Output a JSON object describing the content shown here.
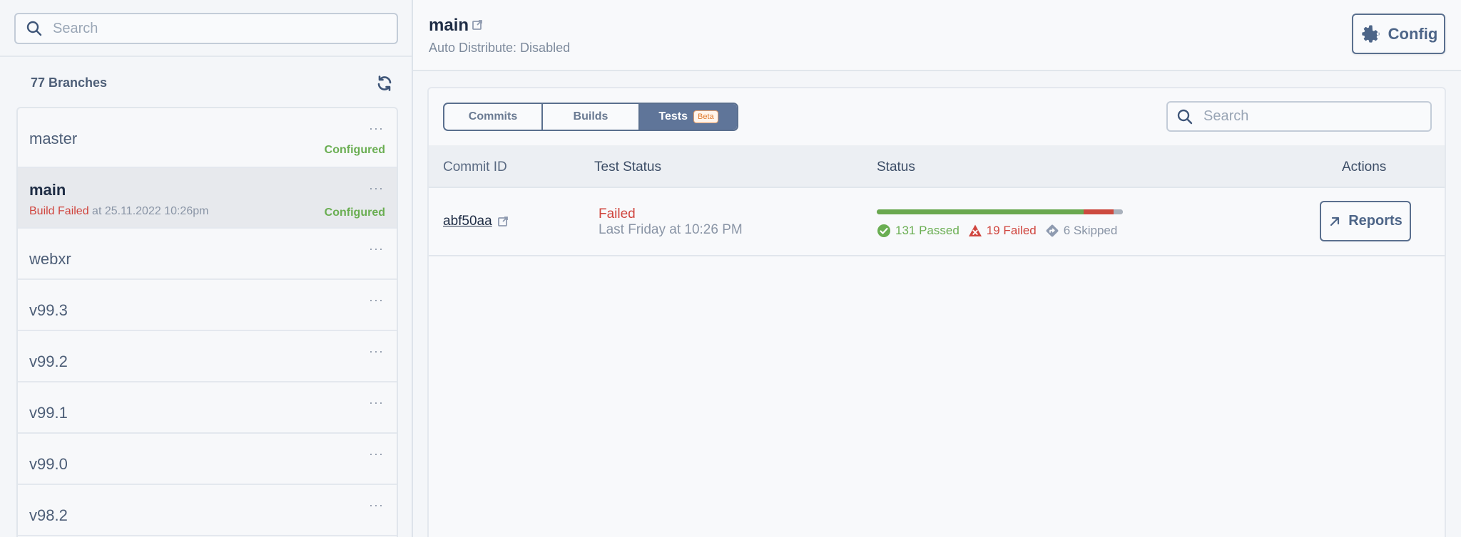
{
  "sidebar": {
    "search_placeholder": "Search",
    "branch_count": "77 Branches",
    "branches": [
      {
        "name": "master",
        "status": "Configured"
      },
      {
        "name": "main",
        "build_status": "Build Failed",
        "build_time": " at 25.11.2022 10:26pm",
        "status": "Configured"
      },
      {
        "name": "webxr"
      },
      {
        "name": "v99.3"
      },
      {
        "name": "v99.2"
      },
      {
        "name": "v99.1"
      },
      {
        "name": "v99.0"
      },
      {
        "name": "v98.2"
      }
    ],
    "more_label": "···"
  },
  "header": {
    "title": "main",
    "subtitle": "Auto Distribute: Disabled",
    "config_label": "Config"
  },
  "tabs": {
    "commits": "Commits",
    "builds": "Builds",
    "tests": "Tests",
    "beta": "Beta"
  },
  "main_search_placeholder": "Search",
  "table": {
    "columns": [
      "Commit ID",
      "Test Status",
      "Status",
      "Actions"
    ],
    "rows": [
      {
        "commit_id": "abf50aa",
        "test_status": "Failed",
        "test_time": "Last Friday at 10:26 PM",
        "passed": 131,
        "failed": 19,
        "skipped": 6,
        "passed_label": "131 Passed",
        "failed_label": "19 Failed",
        "skipped_label": "6 Skipped",
        "action_label": "Reports"
      }
    ]
  },
  "colors": {
    "accent": "#5f7599",
    "passed": "#6aa84f",
    "failed": "#cc4a3f",
    "skipped": "#a9b1bc",
    "configured": "#6aae52"
  },
  "icons": {
    "search": "search-icon",
    "refresh": "refresh-icon",
    "external_link": "external-link-icon",
    "gear": "gear-icon",
    "check": "check-circle-icon",
    "warning": "warning-x-icon",
    "skip": "skip-diamond-icon",
    "arrow": "arrow-up-right-icon"
  }
}
